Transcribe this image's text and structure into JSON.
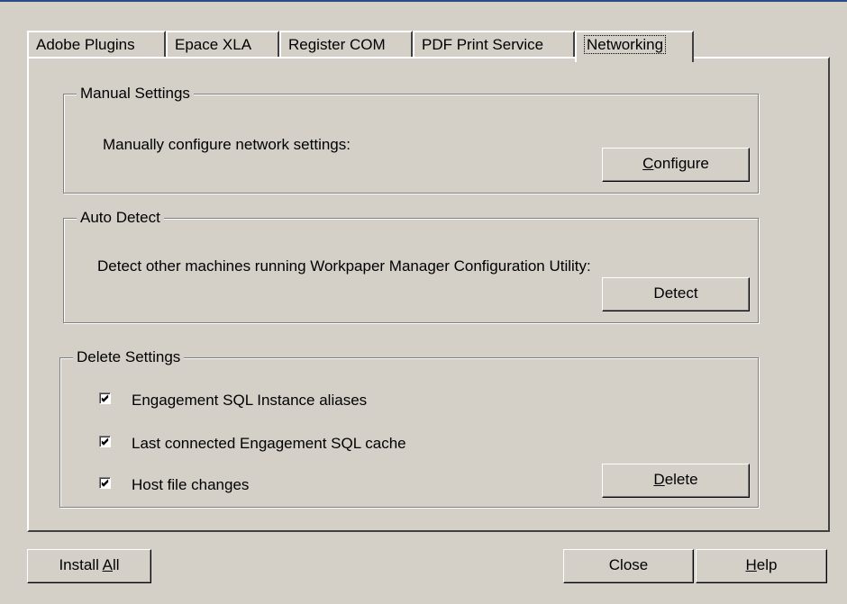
{
  "tabs": [
    "Adobe Plugins",
    "Epace XLA",
    "Register COM",
    "PDF Print Service",
    "Networking"
  ],
  "manual": {
    "title": "Manual Settings",
    "description": "Manually configure network settings:",
    "button_pre": "",
    "button_mnemonic": "C",
    "button_post": "onfigure"
  },
  "auto": {
    "title": "Auto Detect",
    "description": "Detect other machines running Workpaper Manager Configuration Utility:",
    "button": "Detect"
  },
  "delete": {
    "title": "Delete Settings",
    "options": [
      {
        "label": "Engagement SQL Instance aliases",
        "checked": true
      },
      {
        "label": "Last connected Engagement SQL cache",
        "checked": true
      },
      {
        "label": "Host file changes",
        "checked": true
      }
    ],
    "button_mnemonic": "D",
    "button_post": "elete"
  },
  "footer": {
    "install_pre": "Install ",
    "install_mnemonic": "A",
    "install_post": "ll",
    "close": "Close",
    "help_mnemonic": "H",
    "help_post": "elp"
  }
}
